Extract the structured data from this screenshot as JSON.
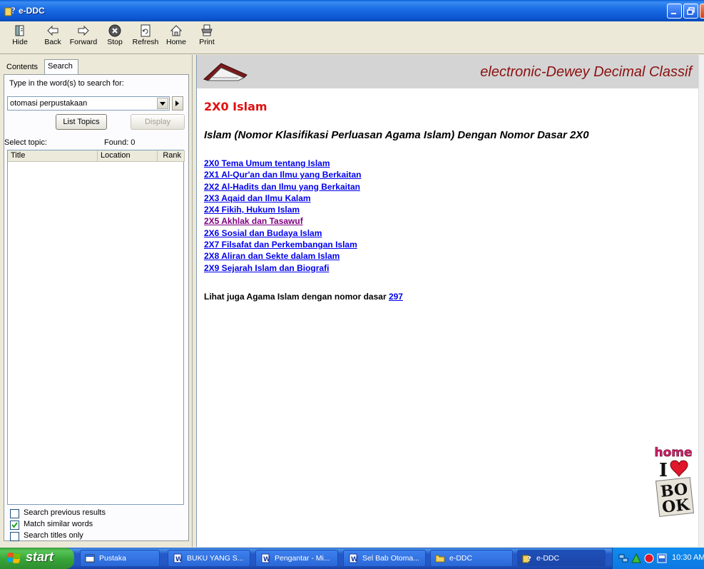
{
  "window": {
    "title": "e-DDC"
  },
  "toolbar": {
    "hide": "Hide",
    "back": "Back",
    "forward": "Forward",
    "stop": "Stop",
    "refresh": "Refresh",
    "home": "Home",
    "print": "Print"
  },
  "left": {
    "tabs": [
      "Contents",
      "Search"
    ],
    "prompt": "Type in the word(s) to search for:",
    "search_value": "otomasi perpustakaan",
    "list_topics": "List Topics",
    "display": "Display",
    "select_topic": "Select topic:",
    "found": "Found: 0",
    "columns": [
      "Title",
      "Location",
      "Rank"
    ],
    "options": [
      {
        "label": "Search previous results",
        "checked": false
      },
      {
        "label": "Match similar words",
        "checked": true
      },
      {
        "label": "Search titles only",
        "checked": false
      }
    ]
  },
  "content": {
    "banner_title": "electronic-Dewey Decimal Classif",
    "heading": "2X0 Islam",
    "subheading": "Islam (Nomor Klasifikasi Perluasan Agama Islam) Dengan Nomor Dasar 2X0",
    "links": [
      "2X0 Tema Umum tentang Islam",
      "2X1 Al-Qur'an dan Ilmu yang Berkaitan",
      "2X2 Al-Hadits dan Ilmu yang Berkaitan",
      "2X3 Aqaid dan Ilmu Kalam",
      "2X4 Fikih, Hukum Islam",
      "2X5 Akhlak dan Tasawuf",
      "2X6 Sosial dan Budaya Islam",
      "2X7 Filsafat dan Perkembangan Islam",
      "2X8 Aliran dan Sekte dalam Islam",
      "2X9 Sejarah Islam dan Biografi"
    ],
    "see_also_text": "Lihat juga Agama Islam dengan nomor dasar ",
    "see_also_link": "297",
    "book_logo": {
      "line1": "home",
      "line2": "I",
      "line3": "BO",
      "line4": "OK"
    }
  },
  "taskbar": {
    "start": "start",
    "tasks": [
      "Pustaka",
      "BUKU YANG S...",
      "Pengantar - Mi...",
      "Sel Bab Otoma...",
      "e-DDC",
      "e-DDC"
    ],
    "clock": "10:30 AM"
  },
  "colors": {
    "heading": "#e01010",
    "banner_title": "#8b1010",
    "link": "#0000ee",
    "visited": "#800080"
  }
}
